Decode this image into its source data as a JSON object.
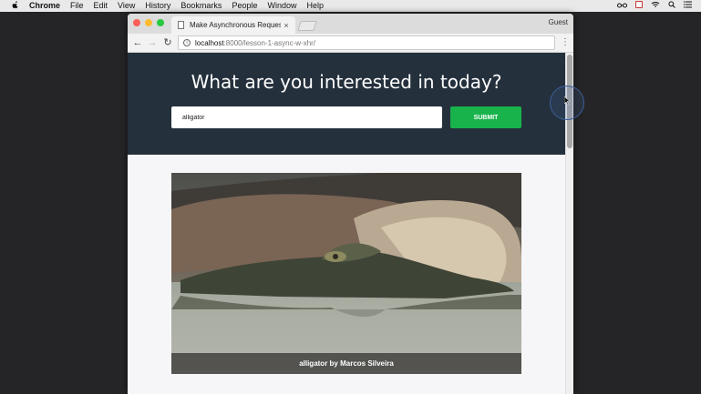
{
  "menubar": {
    "apple": "",
    "app_name": "Chrome",
    "items": [
      "File",
      "Edit",
      "View",
      "History",
      "Bookmarks",
      "People",
      "Window",
      "Help"
    ]
  },
  "browser": {
    "tab_title": "Make Asynchronous Requests",
    "tab_close": "×",
    "profile": "Guest",
    "url_host": "localhost",
    "url_path": ":8000/lesson-1-async-w-xhr/",
    "back": "←",
    "forward": "→",
    "reload": "↻",
    "menu": "⋮"
  },
  "page": {
    "heading": "What are you interested in today?",
    "search_value": "alligator",
    "submit_label": "SUBMIT",
    "image_caption": "alligator by Marcos Silveira"
  },
  "colors": {
    "hero_bg": "#24303c",
    "submit_bg": "#19b34c"
  }
}
